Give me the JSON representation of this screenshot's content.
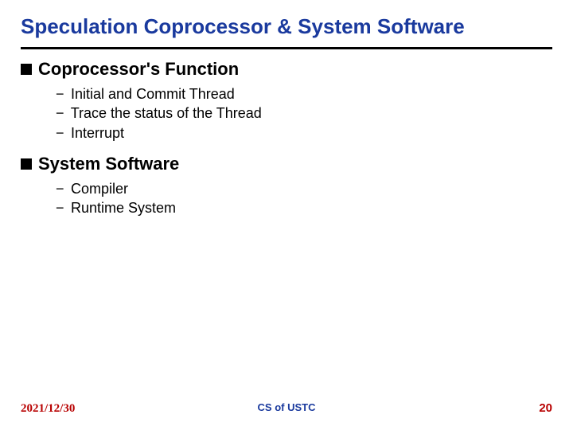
{
  "title": "Speculation Coprocessor & System Software",
  "sections": [
    {
      "heading": "Coprocessor's Function",
      "items": [
        "Initial and Commit Thread",
        "Trace the status of the Thread",
        "Interrupt"
      ]
    },
    {
      "heading": "System Software",
      "items": [
        "Compiler",
        "Runtime System"
      ]
    }
  ],
  "footer": {
    "date": "2021/12/30",
    "center": "CS of USTC",
    "page": "20"
  }
}
